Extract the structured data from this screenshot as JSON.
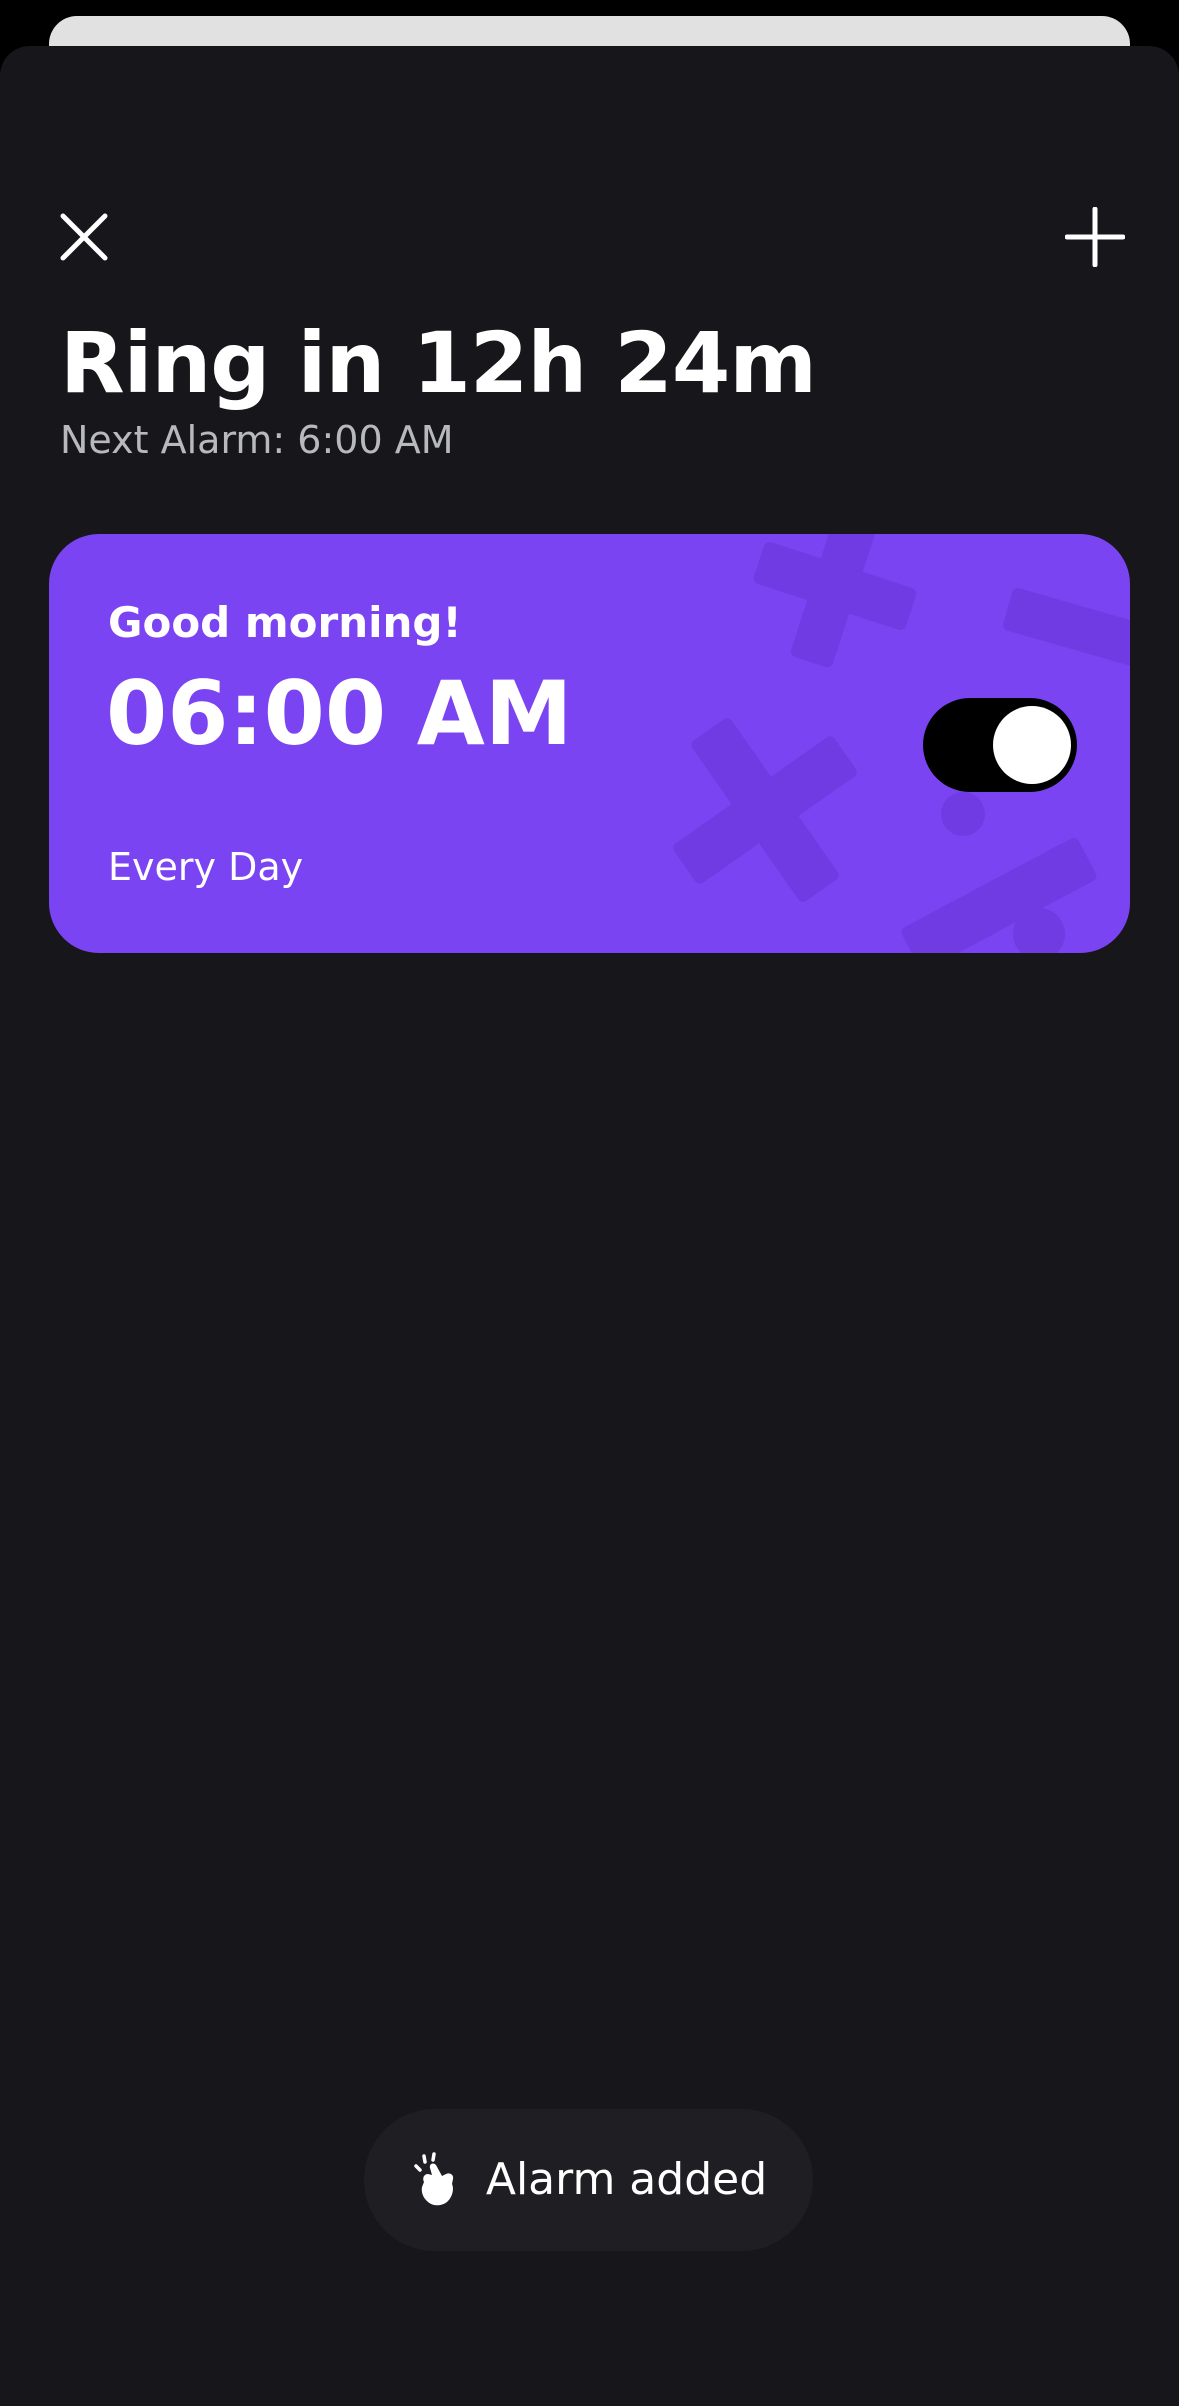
{
  "header": {
    "close_icon": "close-icon",
    "add_icon": "plus-icon",
    "title": "Ring in 12h 24m",
    "subtitle": "Next Alarm: 6:00 AM"
  },
  "alarms": [
    {
      "label": "Good morning!",
      "time": "06:00 AM",
      "repeat": "Every Day",
      "enabled": true
    }
  ],
  "toast": {
    "icon": "snap-hand-icon",
    "text": "Alarm added"
  },
  "colors": {
    "sheet_background": "#17171b",
    "card_accent": "#7b44f2",
    "peek_sheet": "#e1e1e1"
  }
}
